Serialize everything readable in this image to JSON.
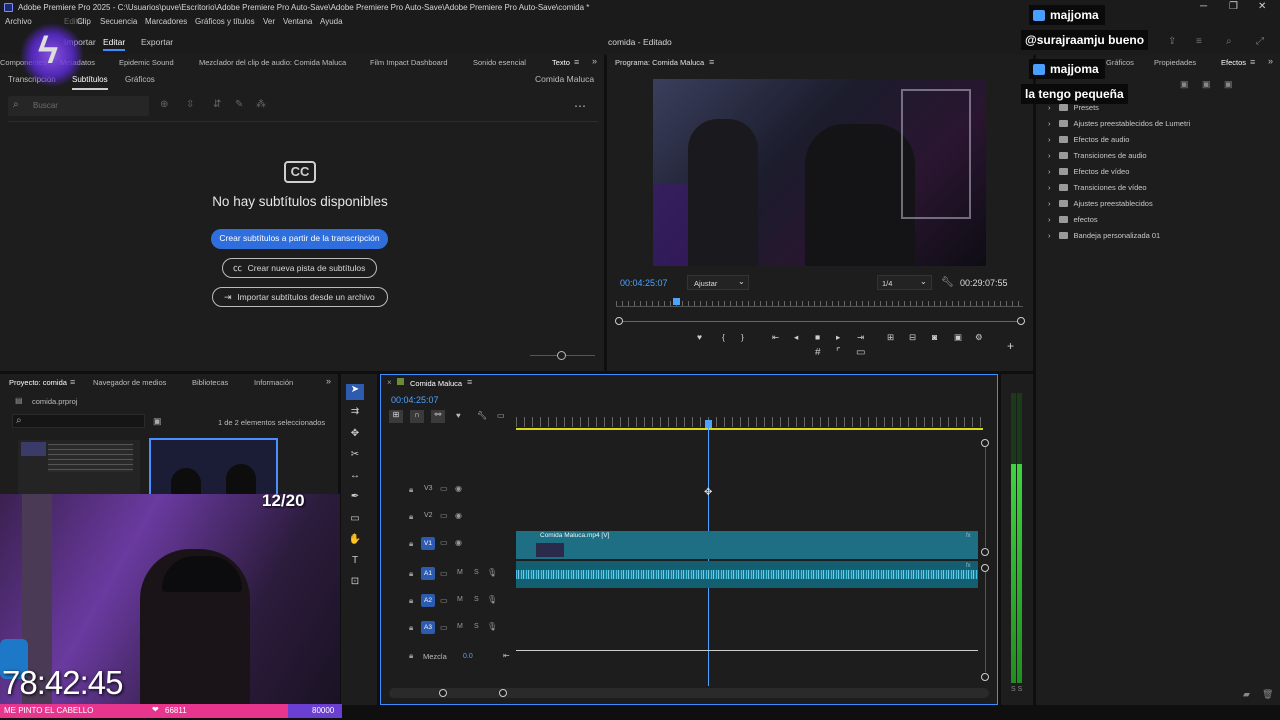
{
  "titlebar": {
    "text": "Adobe Premiere Pro 2025 - C:\\Usuarios\\puve\\Escritorio\\Adobe Premiere Pro Auto-Save\\Adobe Premiere Pro Auto-Save\\Adobe Premiere Pro Auto-Save\\comida *"
  },
  "menu": [
    "Archivo",
    "Editar",
    "Clip",
    "Secuencia",
    "Marcadores",
    "Gráficos y títulos",
    "Ver",
    "Ventana",
    "Ayuda"
  ],
  "workspace": {
    "tabs": [
      "Importar",
      "Editar",
      "Exportar"
    ],
    "active": "Editar",
    "sequence_title": "comida - Editado"
  },
  "top_left_panel": {
    "tabs": [
      "Componentes",
      "Metadatos",
      "Epidemic Sound",
      "Mezclador del clip de audio: Comida Maluca",
      "Film Impact Dashboard",
      "Sonido esencial",
      "Texto"
    ],
    "subtabs": [
      "Transcripción",
      "Subtítulos",
      "Gráficos"
    ],
    "sequence_name": "Comida Maluca",
    "search_placeholder": "Buscar",
    "cc_label": "CC",
    "empty_title": "No hay subtítulos disponibles",
    "btn_create": "Crear subtítulos a partir de la transcripción",
    "btn_new_track": "Crear nueva pista de subtítulos",
    "btn_import": "Importar subtítulos desde un archivo"
  },
  "program_monitor": {
    "title": "Programa: Comida Maluca",
    "timecode": "00:04:25:07",
    "fit": "Ajustar",
    "resolution": "1/4",
    "duration": "00:29:07:55"
  },
  "effects_panel": {
    "tabs": [
      "Gráficos",
      "Propiedades",
      "Efectos"
    ],
    "items": [
      "Presets",
      "Ajustes preestablecidos de Lumetri",
      "Efectos de audio",
      "Transiciones de audio",
      "Efectos de vídeo",
      "Transiciones de vídeo",
      "Ajustes preestablecidos",
      "efectos",
      "Bandeja personalizada 01"
    ]
  },
  "project_panel": {
    "tabs": [
      "Proyecto: comida",
      "Navegador de medios",
      "Bibliotecas",
      "Información"
    ],
    "file": "comida.prproj",
    "selection": "1 de 2 elementos seleccionados"
  },
  "timeline": {
    "tab": "Comida Maluca",
    "timecode": "00:04:25:07",
    "video_tracks": [
      "V3",
      "V2",
      "V1"
    ],
    "audio_tracks": [
      "A1",
      "A2",
      "A3"
    ],
    "mix_label": "Mezcla",
    "mix_value": "0.0",
    "clip_name": "Comida Maluca.mp4 [V]",
    "mute": "M",
    "solo": "S"
  },
  "meters": {
    "label": "S S"
  },
  "overlay": {
    "chat": [
      {
        "user": "majjoma",
        "message": "@surajraamju bueno"
      },
      {
        "user": "majjoma",
        "message": "la tengo pequeña"
      }
    ],
    "counter": "12/20",
    "timer": "78:42:45",
    "bar_left": "ME PINTO EL CABELLO",
    "bar_mid": "66811",
    "bar_right": "80000"
  },
  "colors": {
    "accent": "#3c8dff",
    "clip": "#1f7a8c",
    "audio_wave": "#4fd8ff",
    "pink": "#e8368f",
    "purple": "#6a3fd1"
  }
}
